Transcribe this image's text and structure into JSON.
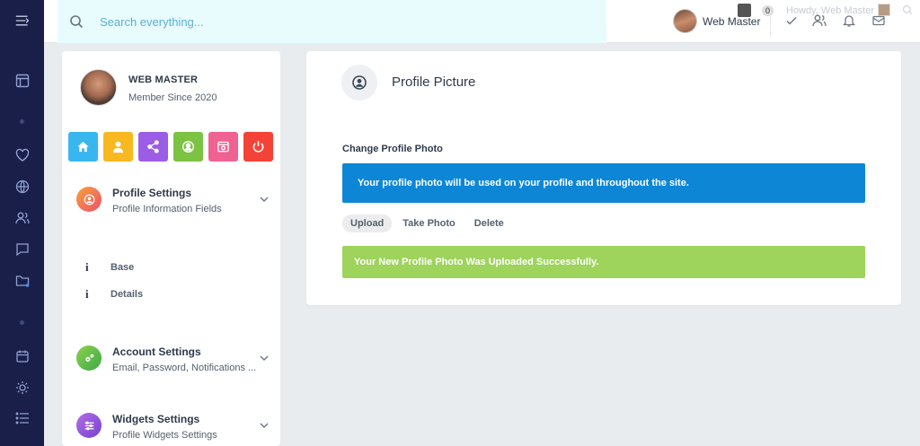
{
  "search": {
    "placeholder": "Search everything..."
  },
  "topbar": {
    "user_name": "Web Master",
    "notification_count": "0",
    "howdy": "Howdy, Web Master"
  },
  "profile": {
    "name": "WEB MASTER",
    "member_since": "Member Since 2020",
    "quick_buttons": [
      {
        "icon": "home-icon",
        "color": "#38b6f0"
      },
      {
        "icon": "user-icon",
        "color": "#f8b820"
      },
      {
        "icon": "share-icon",
        "color": "#9b5de5"
      },
      {
        "icon": "avatar-icon",
        "color": "#7cc243"
      },
      {
        "icon": "card-icon",
        "color": "#f06292"
      },
      {
        "icon": "power-icon",
        "color": "#f44336"
      }
    ],
    "sections": [
      {
        "title": "Profile Settings",
        "subtitle": "Profile Information Fields",
        "color": "#f36a3c"
      },
      {
        "title": "Account Settings",
        "subtitle": "Email, Password, Notifications ...",
        "color": "#6cc04a"
      },
      {
        "title": "Widgets Settings",
        "subtitle": "Profile Widgets Settings",
        "color": "#8b4fd6"
      }
    ],
    "sub_items": [
      {
        "icon": "i",
        "label": "Base"
      },
      {
        "icon": "i",
        "label": "Details"
      }
    ]
  },
  "main": {
    "title": "Profile Picture",
    "change_label": "Change Profile Photo",
    "info_message": "Your profile photo will be used on your profile and throughout the site.",
    "tabs": [
      "Upload",
      "Take Photo",
      "Delete"
    ],
    "success_message": "Your New Profile Photo Was Uploaded Successfully."
  },
  "colors": {
    "rail": "#1a1f4a",
    "info": "#0d86d6",
    "success": "#9ed35c",
    "search_bg": "#e8fbfd"
  }
}
